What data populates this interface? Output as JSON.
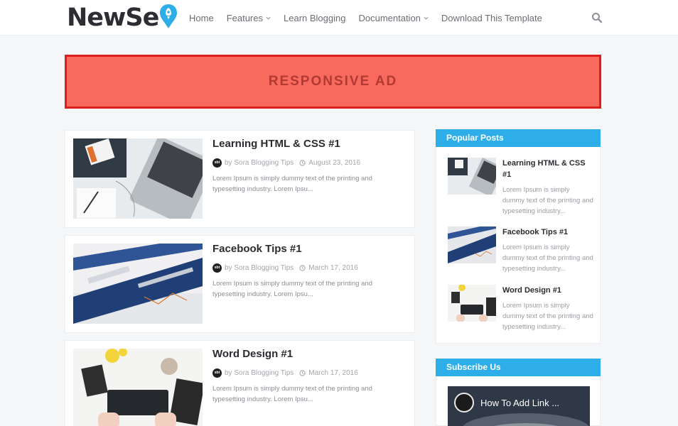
{
  "site": {
    "logo": "NewSe"
  },
  "nav": {
    "items": [
      {
        "label": "Home",
        "dropdown": false
      },
      {
        "label": "Features",
        "dropdown": true
      },
      {
        "label": "Learn Blogging",
        "dropdown": false
      },
      {
        "label": "Documentation",
        "dropdown": true
      },
      {
        "label": "Download This Template",
        "dropdown": false
      }
    ]
  },
  "ad": {
    "label": "RESPONSIVE AD"
  },
  "posts": [
    {
      "title": "Learning HTML & CSS #1",
      "author": "by Sora Blogging Tips",
      "date": "August 23, 2016",
      "excerpt": "Lorem Ipsum is simply dummy text of the printing and typesetting industry. Lorem Ipsu..."
    },
    {
      "title": "Facebook Tips #1",
      "author": "by Sora Blogging Tips",
      "date": "March 17, 2016",
      "excerpt": "Lorem Ipsum is simply dummy text of the printing and typesetting industry. Lorem Ipsu..."
    },
    {
      "title": "Word Design #1",
      "author": "by Sora Blogging Tips",
      "date": "March 17, 2016",
      "excerpt": "Lorem Ipsum is simply dummy text of the printing and typesetting industry. Lorem Ipsu..."
    }
  ],
  "author_avatar": "sbt",
  "sidebar": {
    "popular": {
      "title": "Popular Posts",
      "items": [
        {
          "title": "Learning HTML & CSS #1",
          "excerpt": "Lorem Ipsum is simply dummy text of the printing and typesetting industry..."
        },
        {
          "title": "Facebook Tips #1",
          "excerpt": "Lorem Ipsum is simply dummy text of the printing and typesetting industry..."
        },
        {
          "title": "Word Design #1",
          "excerpt": "Lorem Ipsum is simply dummy text of the printing and typesetting industry..."
        }
      ]
    },
    "subscribe": {
      "title": "Subscribe Us",
      "video_title": "How To Add Link ..."
    }
  },
  "colors": {
    "accent": "#2eaee8",
    "ad_fill": "#f8695e",
    "ad_border": "#dc1f1a"
  }
}
